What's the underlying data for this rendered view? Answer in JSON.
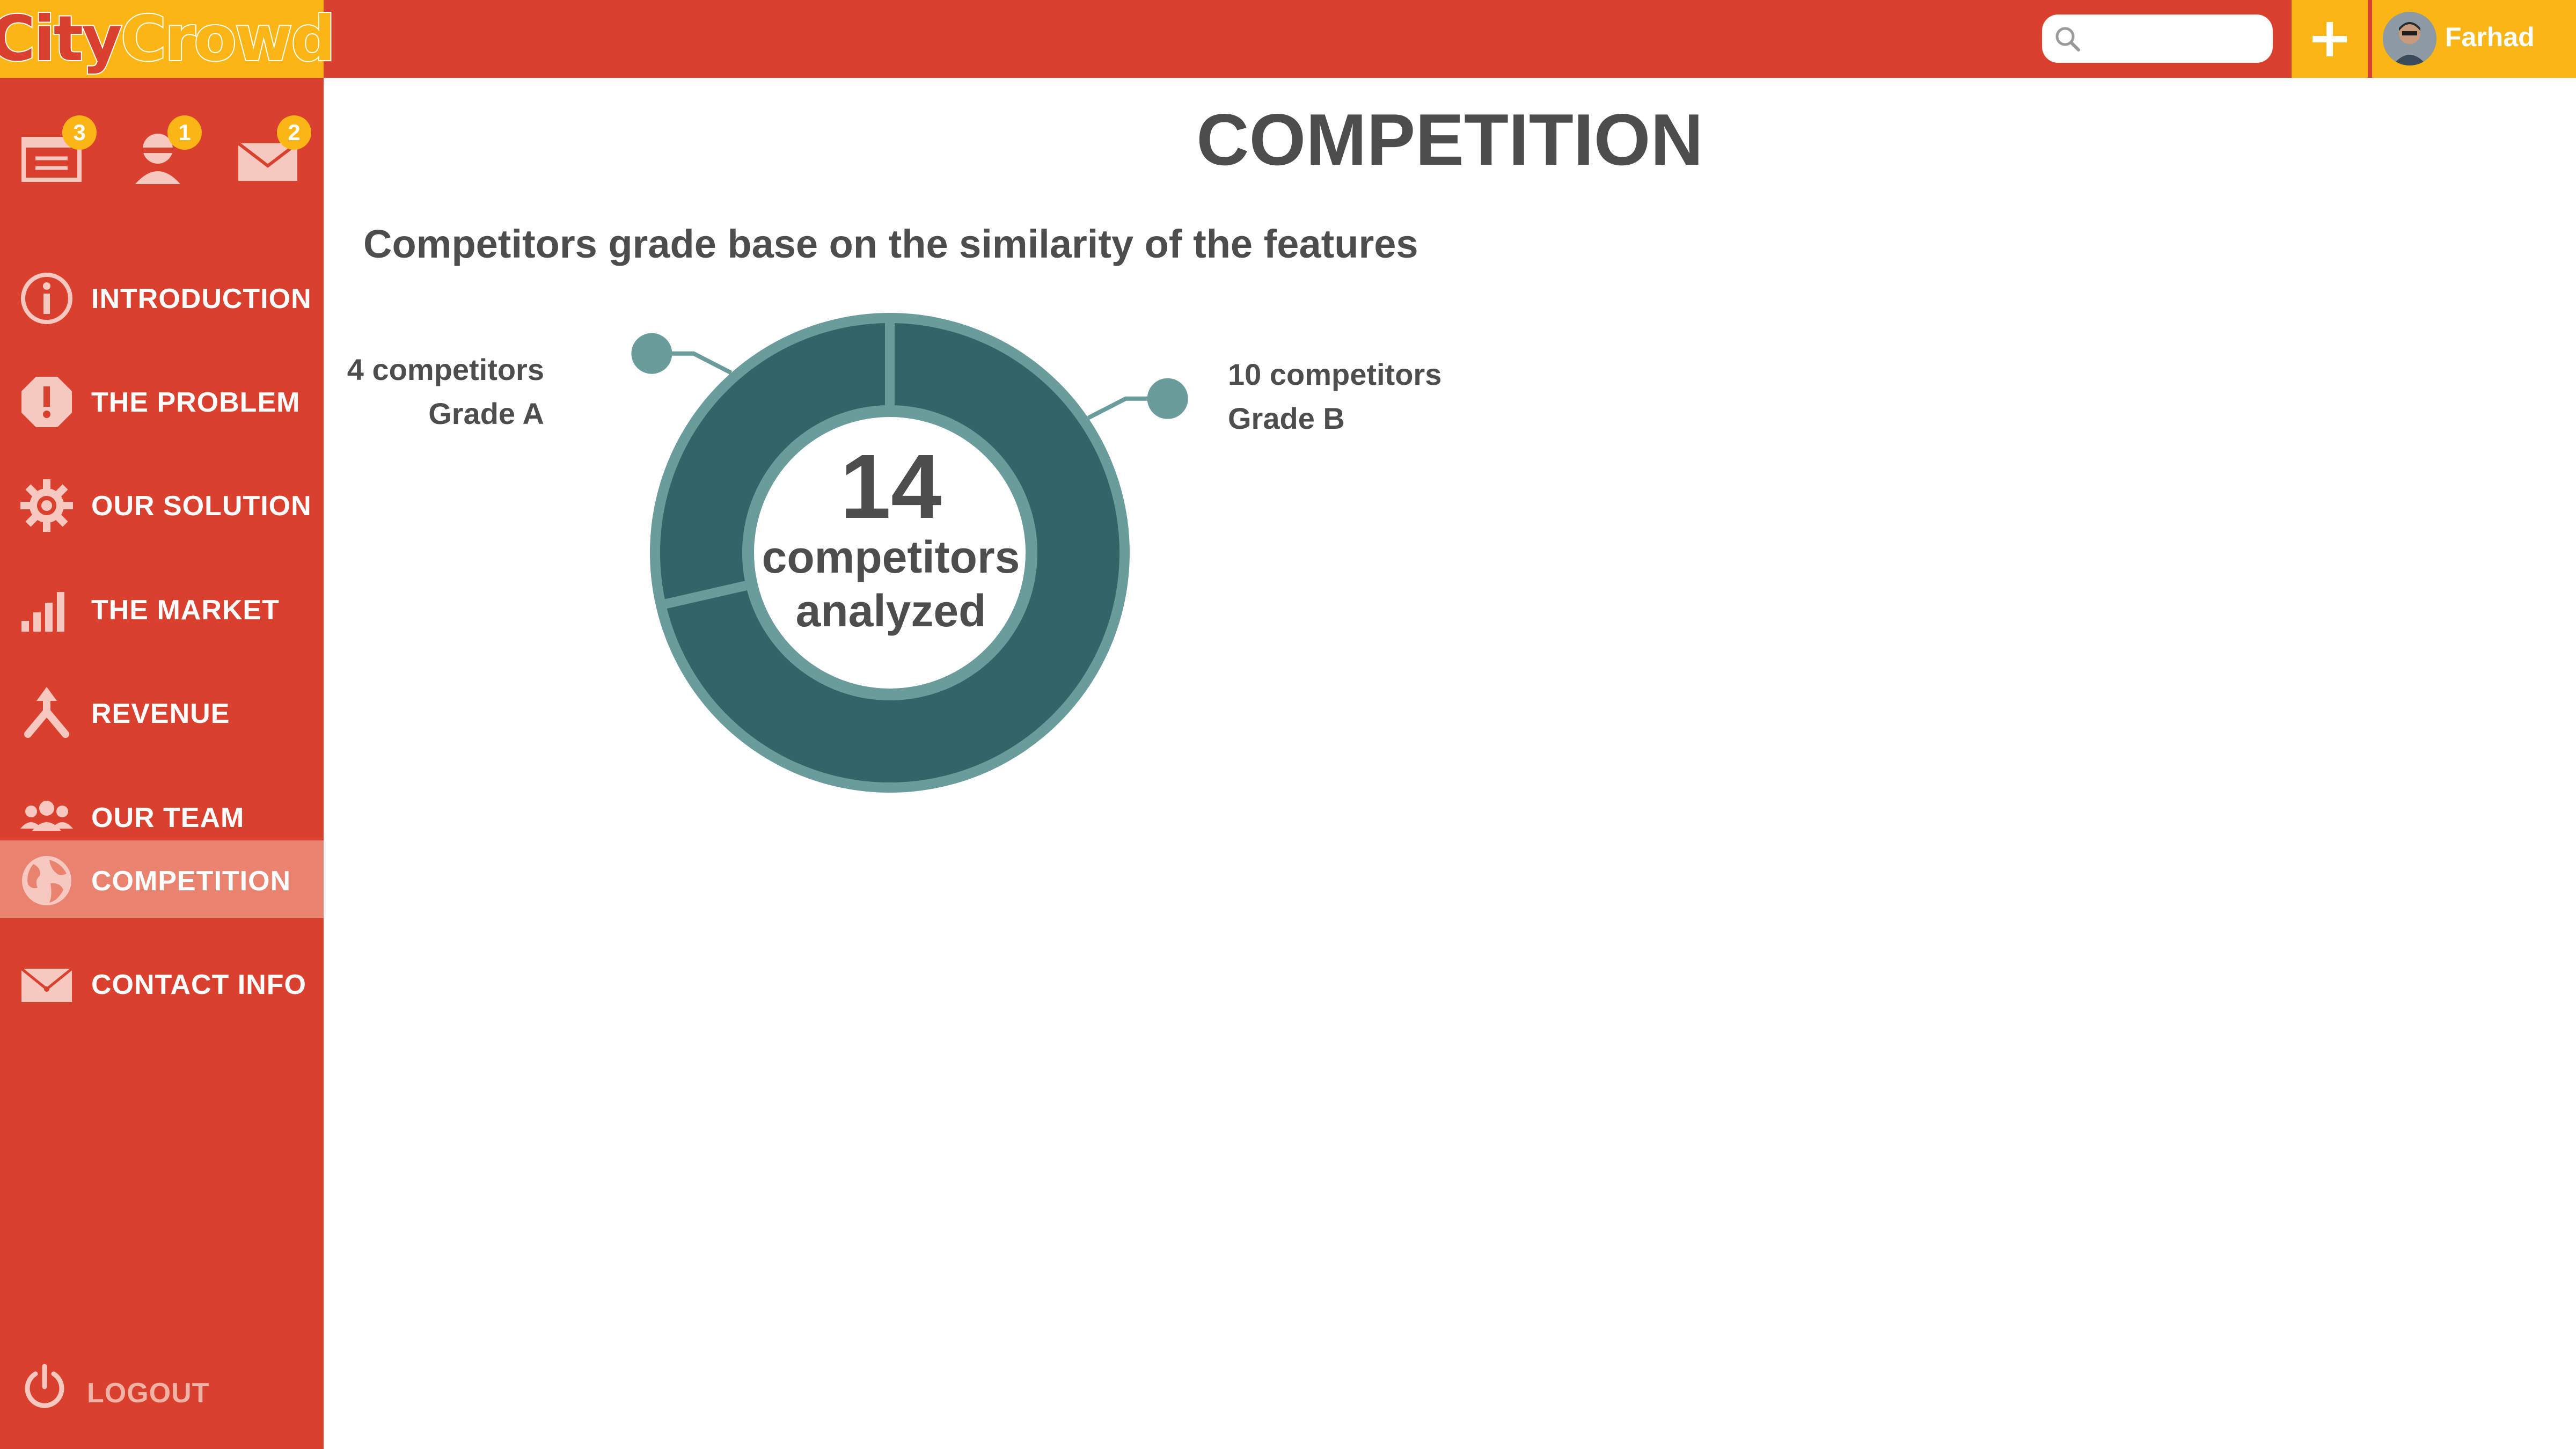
{
  "app": {
    "logo_city": "City",
    "logo_crowd": "Crowd"
  },
  "topbar": {
    "search_placeholder": "",
    "add_icon": "plus-icon",
    "user_name": "Farhad"
  },
  "notifications": [
    {
      "icon": "inbox-icon",
      "count": "3"
    },
    {
      "icon": "user-icon",
      "count": "1"
    },
    {
      "icon": "mail-icon",
      "count": "2"
    }
  ],
  "sidebar": {
    "items": [
      {
        "label": "INTRODUCTION",
        "icon": "info-icon"
      },
      {
        "label": "THE PROBLEM",
        "icon": "warning-icon"
      },
      {
        "label": "OUR SOLUTION",
        "icon": "gear-icon"
      },
      {
        "label": "THE MARKET",
        "icon": "bar-chart-icon"
      },
      {
        "label": "REVENUE",
        "icon": "split-arrow-icon"
      },
      {
        "label": "OUR TEAM",
        "icon": "team-icon"
      },
      {
        "label": "COMPETITION",
        "icon": "globe-icon",
        "active": true
      },
      {
        "label": "CONTACT INFO",
        "icon": "envelope-icon"
      }
    ],
    "logout_label": "LOGOUT"
  },
  "page": {
    "title": "COMPETITION",
    "subtitle": "Competitors grade base on the similarity of the features"
  },
  "chart_data": {
    "type": "pie",
    "total_value": "14",
    "total_caption_line1": "competitors",
    "total_caption_line2": "analyzed",
    "segments": [
      {
        "name": "Grade A",
        "value": 4,
        "label_line1": "4 competitors",
        "label_line2": "Grade A"
      },
      {
        "name": "Grade B",
        "value": 10,
        "label_line1": "10 competitors",
        "label_line2": "Grade B"
      }
    ],
    "colors": {
      "ring": "#326567",
      "outline": "#6a9c9c",
      "connector": "#6a9c9c"
    }
  }
}
